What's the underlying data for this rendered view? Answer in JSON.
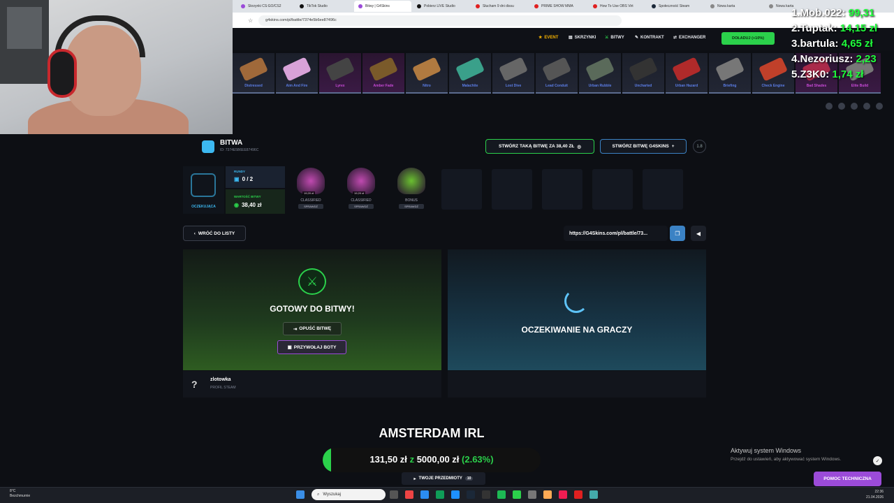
{
  "browser": {
    "tabs": [
      {
        "label": "Skrzynki CS:GO/CS2",
        "color": "#9b4bd8"
      },
      {
        "label": "TikTok Studio",
        "color": "#111111"
      },
      {
        "label": "Bitwy | G4Skins",
        "color": "#9b4bd8"
      },
      {
        "label": "Pobierz LIVE Studio",
        "color": "#111111"
      },
      {
        "label": "Słucham 9 dni dissu",
        "color": "#e02020"
      },
      {
        "label": "PRIME SHOW MMA",
        "color": "#e02020"
      },
      {
        "label": "How To Use OBS Virt",
        "color": "#e02020"
      },
      {
        "label": "Społeczność Steam",
        "color": "#1b2838"
      },
      {
        "label": "Nowa karta",
        "color": "#888888"
      },
      {
        "label": "Nowa karta",
        "color": "#888888"
      }
    ],
    "url": "g4skins.com/pl/battle/7374e5b6ee87496c"
  },
  "nav": {
    "event": "EVENT",
    "cases": "SKRZYNKI",
    "battles": "BITWY",
    "contract": "KONTRAKT",
    "exchanger": "EXCHANGER",
    "topup": "DOŁADUJ (+10%)"
  },
  "drops": [
    "Distressed",
    "Aim And Fire",
    "Lyrex",
    "Amber Fade",
    "Nitro",
    "Malachite",
    "Lost Dive",
    "Lead Conduit",
    "Urban Rubble",
    "Uncharted",
    "Urban Hazard",
    "Briefing",
    "Check Engine",
    "Bad Shades",
    "Elite Build"
  ],
  "leaderboard": [
    {
      "name": "1.Mob.022:",
      "value": "99,31"
    },
    {
      "name": "2.Tuptak:",
      "value": "14,15 zł"
    },
    {
      "name": "3.bartula:",
      "value": "4,65 zł"
    },
    {
      "name": "4.Nezoriusz:",
      "value": "2,23"
    },
    {
      "name": "5.Z3K0:",
      "value": "1,74 zł"
    }
  ],
  "battle": {
    "title": "BITWA",
    "id": "ID: 7374E5B6EE87496C",
    "create_same": "STWÓRZ TAKĄ BITWĘ ZA 38,40 ZŁ",
    "create_g4": "STWÓRZ BITWĘ G4SKINS",
    "badge": "1.8",
    "status": "OCZEKUJĄCA",
    "rounds_label": "RUNDY",
    "rounds_value": "0 / 2",
    "value_label": "WARTOŚĆ BITWY",
    "value_value": "38,40 zł",
    "cases": [
      {
        "name": "CLASSIFIED",
        "price": "19,20 zł",
        "tag": "SPRAWDŹ"
      },
      {
        "name": "CLASSIFIED",
        "price": "19,20 zł",
        "tag": "SPRAWDŹ"
      },
      {
        "name": "BONUS",
        "price": "",
        "tag": "SPRAWDŹ"
      }
    ],
    "back": "WRÓĆ DO LISTY",
    "link": "https://G4Skins.com/pl/battle/73..."
  },
  "panels": {
    "ready": "GOTOWY DO BITWY!",
    "leave": "OPUŚĆ BITWĘ",
    "bots": "PRZYWOŁAJ BOTY",
    "waiting": "OCZEKIWANIE NA GRACZY",
    "player_name": "zlotowka",
    "player_sub": "PROFIL STEAM"
  },
  "overlay": {
    "irl_title": "AMSTERDAM IRL",
    "goal_current": "131,50 zł",
    "goal_sep": "z",
    "goal_target": "5000,00 zł",
    "goal_pct": "(2.63%)",
    "goal_fraction": 0.0263
  },
  "items_btn": "TWOJE PRZEDMIOTY",
  "items_count": "10",
  "windows": {
    "activate": "Aktywuj system Windows",
    "activate_sub": "Przejdź do ustawień, aby aktywować system Windows."
  },
  "help": "POMOC TECHNICZNA",
  "taskbar": {
    "temp": "8°C",
    "weather": "Bezchmurnie",
    "search": "Wyszukaj",
    "time": "22:36",
    "date": "21.04.2026"
  }
}
